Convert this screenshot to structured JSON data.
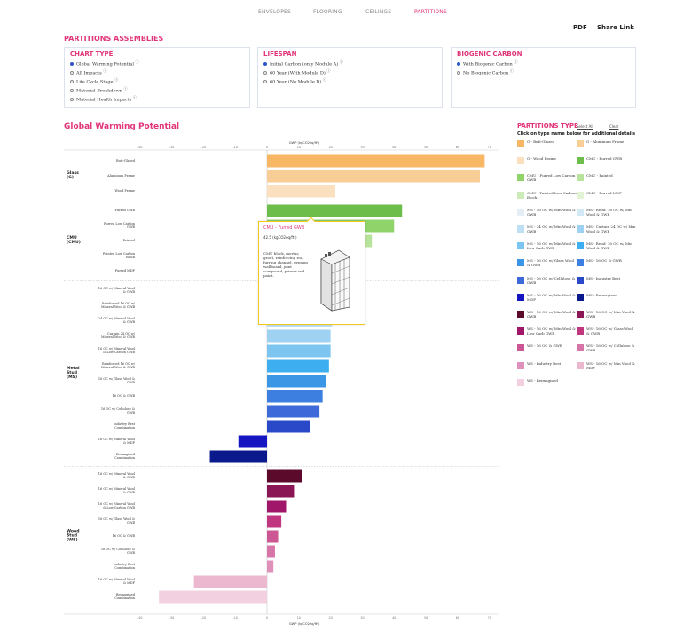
{
  "nav": {
    "tabs": [
      {
        "label": "ENVELOPES",
        "active": false
      },
      {
        "label": "FLOORING",
        "active": false
      },
      {
        "label": "CEILINGS",
        "active": false
      },
      {
        "label": "PARTITIONS",
        "active": true
      }
    ]
  },
  "utility": {
    "pdf": "PDF",
    "share": "Share Link"
  },
  "heading": "PARTITIONS ASSEMBLIES",
  "panels": {
    "chart_type": {
      "title": "CHART TYPE",
      "options": [
        {
          "label": "Global Warming Potential",
          "selected": true
        },
        {
          "label": "All Impacts",
          "selected": false
        },
        {
          "label": "Life Cycle Stage",
          "selected": false
        },
        {
          "label": "Material Breakdown",
          "selected": false
        },
        {
          "label": "Material Health Impacts",
          "selected": false
        }
      ]
    },
    "lifespan": {
      "title": "LIFESPAN",
      "options": [
        {
          "label": "Initial Carbon (only Module A)",
          "selected": true
        },
        {
          "label": "60 Year (With Module D)",
          "selected": false
        },
        {
          "label": "60 Year (No Module D)",
          "selected": false
        }
      ]
    },
    "biogenic": {
      "title": "BIOGENIC CARBON",
      "options": [
        {
          "label": "With Biogenic Carbon",
          "selected": true
        },
        {
          "label": "No Biogenic Carbon",
          "selected": false
        }
      ]
    }
  },
  "chart_title": "Global Warming Potential",
  "chart_data": {
    "type": "bar",
    "orientation": "horizontal",
    "xlabel": "GWP (kgCO2eq/ft²)",
    "xlim": [
      -40,
      70
    ],
    "xticks": [
      -40,
      -30,
      -20,
      -10,
      0,
      10,
      20,
      30,
      40,
      50,
      60,
      70
    ],
    "grid": false,
    "groups": [
      {
        "name": "Glass\n(G)",
        "rows": [
          {
            "label": "Butt-Glazed",
            "value": 68.5,
            "color": "#f7b765"
          },
          {
            "label": "Aluminum Frame",
            "value": 67,
            "color": "#f9cd96"
          },
          {
            "label": "Wood Frame",
            "value": 21.5,
            "color": "#fbe0c0"
          }
        ]
      },
      {
        "name": "CMU\n(CMU)",
        "rows": [
          {
            "label": "Furred GWB",
            "value": 42.5,
            "color": "#6cbd4a"
          },
          {
            "label": "Furred Low Carbon\nGWB",
            "value": 40,
            "color": "#8fd36a"
          },
          {
            "label": "Painted",
            "value": 33,
            "color": "#b7e39c"
          },
          {
            "label": "Painted Low Carbon\nBlock",
            "value": 28,
            "color": "#cdebb8"
          },
          {
            "label": "Furred MDF",
            "value": 25,
            "color": "#e2f3d6"
          }
        ]
      },
      {
        "name": "Metal\nStud\n(MS)",
        "rows": [
          {
            "label": "16 OC w/ Mineral Wool\n& GWB",
            "value": 22,
            "color": "#e3eef7"
          },
          {
            "label": "Reinforced 16 OC w/\nMineral Wool & GWB",
            "value": 21,
            "color": "#d3e8f5"
          },
          {
            "label": "24 OC w/ Mineral Wool\n& GWB",
            "value": 20.5,
            "color": "#bfe0f3"
          },
          {
            "label": "Curtain 24 OC w/\nMineral Wool & GWB",
            "value": 20,
            "color": "#9fd2f2"
          },
          {
            "label": "16 OC w/ Mineral Wool\n& Low Carbon GWB",
            "value": 20,
            "color": "#7cc5f0"
          },
          {
            "label": "Reinforced 16 OC w/\nMineral Wool & GWB",
            "value": 19.5,
            "color": "#3daef0"
          },
          {
            "label": "16 OC w/ Glass Wool &\nGWB",
            "value": 18.5,
            "color": "#3b97e6"
          },
          {
            "label": "16 OC & GWB",
            "value": 17.5,
            "color": "#3d7fe0"
          },
          {
            "label": "16 OC w/ Cellulose &\nGWB",
            "value": 16.5,
            "color": "#3d6ad8"
          },
          {
            "label": "Industry Best\nCombination",
            "value": 13.5,
            "color": "#2a49c8"
          },
          {
            "label": "16 OC w/ Mineral Wool\n& MDF",
            "value": -9,
            "color": "#1515c2"
          },
          {
            "label": "Reimagined\nCombination",
            "value": -18,
            "color": "#0a1a8c"
          }
        ]
      },
      {
        "name": "Wood\nStud\n(WS)",
        "rows": [
          {
            "label": "16 OC w/ Mineral Wool\n& GWB",
            "value": 11,
            "color": "#5c0a2c"
          },
          {
            "label": "16 OC w/ Mineral Wool\n& GWB",
            "value": 8.5,
            "color": "#8b1655"
          },
          {
            "label": "16 OC w/ Mineral Wool\n& Low Carbon GWB",
            "value": 6,
            "color": "#a0176a"
          },
          {
            "label": "16 OC w/ Glass Wool &\nGWB",
            "value": 4.5,
            "color": "#c0377f"
          },
          {
            "label": "16 OC & GWB",
            "value": 3.5,
            "color": "#cc5593"
          },
          {
            "label": "16 OC w/ Cellulose &\nGWB",
            "value": 2.5,
            "color": "#d875a8"
          },
          {
            "label": "Industry Best\nCombination",
            "value": 2,
            "color": "#e091bb"
          },
          {
            "label": "16 OC w/ Mineral Wool\n& MDF",
            "value": -23,
            "color": "#ebb8d0"
          },
          {
            "label": "Reimagined\nCombination",
            "value": -34,
            "color": "#f2d0e0"
          }
        ]
      }
    ]
  },
  "legend": {
    "title": "PARTITIONS TYPE",
    "select_all": "Select All",
    "clear": "Clear",
    "hint": "Click on type name below for additional details",
    "items": [
      {
        "label": "G - Butt-Glazed",
        "color": "#f7b765"
      },
      {
        "label": "G - Aluminum Frame",
        "color": "#f9cd96"
      },
      {
        "label": "G - Wood Frame",
        "color": "#fbe0c0"
      },
      {
        "label": "CMU - Furred GWB",
        "color": "#6cbd4a"
      },
      {
        "label": "CMU - Furred Low Carbon GWB",
        "color": "#8fd36a"
      },
      {
        "label": "CMU - Painted",
        "color": "#b7e39c"
      },
      {
        "label": "CMU - Painted Low Carbon Block",
        "color": "#cdebb8"
      },
      {
        "label": "CMU - Furred MDF",
        "color": "#e2f3d6"
      },
      {
        "label": "MS - 16 OC w/ Min Wool & GWB",
        "color": "#e3eef7"
      },
      {
        "label": "MS - Reinf. 16 OC w/ Min Wool & GWB",
        "color": "#d3e8f5"
      },
      {
        "label": "MS - 24 OC w/ Min Wool & GWB",
        "color": "#bfe0f3"
      },
      {
        "label": "MS - Curtain 24 OC w/ Min Wool & GWB",
        "color": "#9fd2f2"
      },
      {
        "label": "MS - 16 OC w/ Min Wool & Low Carb GWB",
        "color": "#7cc5f0"
      },
      {
        "label": "MS - Reinf. 16 OC w/ Min Wool & GWB",
        "color": "#3daef0"
      },
      {
        "label": "MS - 16 OC w/ Glass Wool & GWB",
        "color": "#3b97e6"
      },
      {
        "label": "MS - 16 OC & GWB",
        "color": "#3d7fe0"
      },
      {
        "label": "MS - 16 OC w/ Cellulose & GWB",
        "color": "#3d6ad8"
      },
      {
        "label": "MS - Industry Best",
        "color": "#2a49c8"
      },
      {
        "label": "MS - 16 OC w/ Min Wool & MDF",
        "color": "#1515c2"
      },
      {
        "label": "MS - Reimagined",
        "color": "#0a1a8c"
      },
      {
        "label": "WS - 16 OC w/ Min Wool & GWB",
        "color": "#5c0a2c"
      },
      {
        "label": "WS - 16 OC w/ Min Wool & GWB",
        "color": "#8b1655"
      },
      {
        "label": "WS - 16 OC w/ Min Wool & Low Carb GWB",
        "color": "#a0176a"
      },
      {
        "label": "WS - 16 OC w/ Glass Wool & GWB",
        "color": "#c0377f"
      },
      {
        "label": "WS - 16 OC & GWB",
        "color": "#cc5593"
      },
      {
        "label": "WS - 16 OC w/ Cellulose & GWB",
        "color": "#d875a8"
      },
      {
        "label": "WS - Industry Best",
        "color": "#e091bb"
      },
      {
        "label": "WS - 16 OC w/ Min Wool & MDF",
        "color": "#ebb8d0"
      },
      {
        "label": "WS - Reimagined",
        "color": "#f2d0e0"
      }
    ]
  },
  "tooltip": {
    "title": "CMU - Furred GWB",
    "value": "42.5 (kgCO2eq/ft²)",
    "description": "CMU block, mortar, grout, reinforcing rod, furring channel, gypsum wallboard, joint compound, primer and paint."
  }
}
